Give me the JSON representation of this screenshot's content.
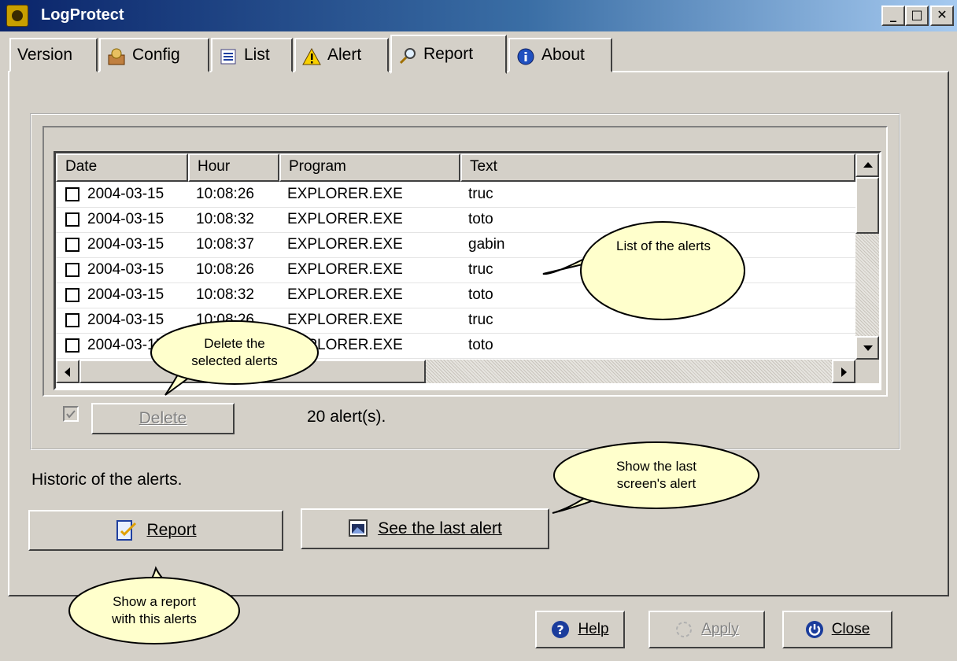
{
  "window": {
    "title": "LogProtect",
    "controls": {
      "minimize": "_",
      "maximize": "□",
      "close": "✕"
    }
  },
  "tabs": [
    {
      "label": "Version",
      "icon": ""
    },
    {
      "label": "Config",
      "icon": "config-icon"
    },
    {
      "label": "List",
      "icon": "list-icon"
    },
    {
      "label": "Alert",
      "icon": "warning-icon"
    },
    {
      "label": "Report",
      "icon": "magnifier-icon",
      "active": true
    },
    {
      "label": "About",
      "icon": "info-icon"
    }
  ],
  "alerts_table": {
    "columns": [
      "Date",
      "Hour",
      "Program",
      "Text"
    ],
    "rows": [
      {
        "date": "2004-03-15",
        "hour": "10:08:26",
        "program": "EXPLORER.EXE",
        "text": "truc"
      },
      {
        "date": "2004-03-15",
        "hour": "10:08:32",
        "program": "EXPLORER.EXE",
        "text": "toto"
      },
      {
        "date": "2004-03-15",
        "hour": "10:08:37",
        "program": "EXPLORER.EXE",
        "text": "gabin"
      },
      {
        "date": "2004-03-15",
        "hour": "10:08:26",
        "program": "EXPLORER.EXE",
        "text": "truc"
      },
      {
        "date": "2004-03-15",
        "hour": "10:08:32",
        "program": "EXPLORER.EXE",
        "text": "toto"
      },
      {
        "date": "2004-03-15",
        "hour": "10:08:26",
        "program": "EXPLORER.EXE",
        "text": "truc"
      },
      {
        "date": "2004-03-15",
        "hour": "",
        "program": "EXPLORER.EXE",
        "text": "toto"
      }
    ]
  },
  "delete_bar": {
    "delete_label": "Delete",
    "count_text": "20 alert(s)."
  },
  "historic_label": "Historic of the alerts.",
  "actions": {
    "report_label": "Report",
    "see_last_label": "See the last alert"
  },
  "footer": {
    "help_label": "Help",
    "apply_label": "Apply",
    "close_label": "Close"
  },
  "callouts": {
    "list_alerts": "List of the alerts",
    "delete_line1": "Delete the",
    "delete_line2": "selected alerts",
    "show_last_line1": "Show the last",
    "show_last_line2": "screen's alert",
    "show_report_line1": "Show a report",
    "show_report_line2": "with this alerts"
  },
  "colors": {
    "face": "#d4d0c8",
    "title_start": "#0a246a",
    "title_end": "#a6caf0",
    "bubble": "#ffffcc"
  }
}
